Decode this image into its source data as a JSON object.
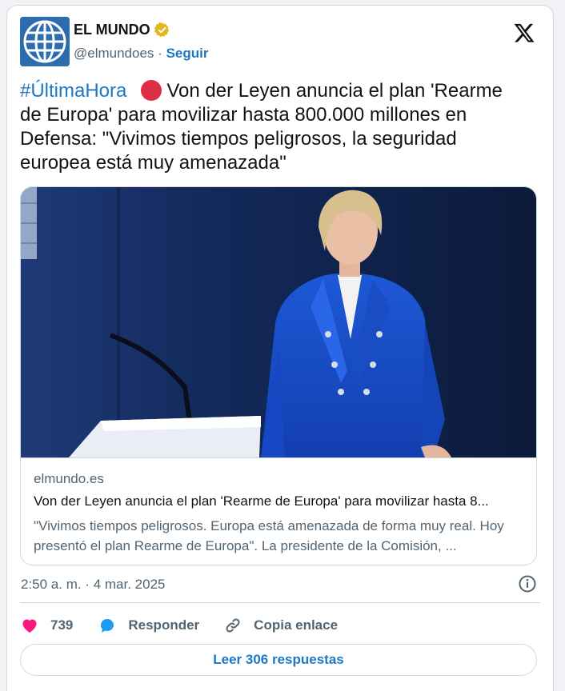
{
  "account": {
    "name": "EL MUNDO",
    "handle": "@elmundoes",
    "separator": "·",
    "follow_label": "Seguir",
    "verified_icon": "verified-badge-gold",
    "avatar_icon": "el-mundo-globe-logo",
    "platform_icon": "x-logo"
  },
  "tweet": {
    "hashtag": "#ÚltimaHora",
    "emoji_icon": "red-circle",
    "text": "Von der Leyen anuncia el plan 'Rearme de Europa' para movilizar hasta 800.000 millones en Defensa: \"Vivimos tiempos peligrosos, la seguridad europea está muy amenazada\""
  },
  "link_card": {
    "image_icon": "photo-woman-blue-jacket",
    "domain": "elmundo.es",
    "title": "Von der Leyen anuncia el plan 'Rearme de Europa' para movilizar hasta 8...",
    "description": "\"Vivimos tiempos peligrosos. Europa está amenazada de forma muy real. Hoy presentó el plan Rearme de Europa\". La presidente de la Comisión, ..."
  },
  "meta": {
    "timestamp": "2:50 a. m. · 4 mar. 2025",
    "info_icon": "info-circle-icon"
  },
  "actions": {
    "like_count": "739",
    "reply_label": "Responder",
    "copy_label": "Copia enlace",
    "read_replies_label": "Leer 306 respuestas"
  },
  "colors": {
    "accent": "#1d77c7",
    "like": "#f91880",
    "red_dot": "#dd2e44",
    "verified": "#e2b719",
    "muted": "#536471"
  }
}
